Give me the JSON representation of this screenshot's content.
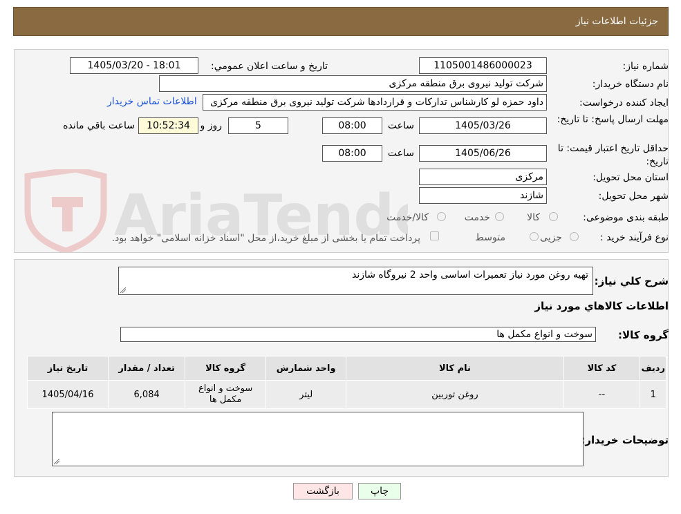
{
  "header": {
    "title": "جزئیات اطلاعات نیاز"
  },
  "watermark": {
    "text": "AriaTender.neT"
  },
  "form": {
    "need_number_label": "شماره نیاز:",
    "need_number": "1105001486000023",
    "announce_label": "تاریخ و ساعت اعلان عمومي:",
    "announce_value": "1405/03/20 - 18:01",
    "buyer_org_label": "نام دستگاه خریدار:",
    "buyer_org": "شرکت تولید نیروی برق منطقه مرکزی",
    "requester_label": "ایجاد کننده درخواست:",
    "requester": "داود حمزه لو کارشناس تدارکات و قراردادها شرکت تولید نیروی برق منطقه مرکزی",
    "contact_link": "اطلاعات تماس خریدار",
    "deadline_label": "مهلت ارسال پاسخ: تا تاریخ:",
    "deadline_date": "1405/03/26",
    "time_label": "ساعت",
    "deadline_time": "08:00",
    "days": "5",
    "days_label": "روز و",
    "remaining_time": "10:52:34",
    "remaining_label": "ساعت باقي مانده",
    "validity_label": "حداقل تاریخ اعتبار قیمت: تا تاریخ:",
    "validity_date": "1405/06/26",
    "validity_time": "08:00",
    "province_label": "استان محل تحویل:",
    "province": "مرکزی",
    "city_label": "شهر محل تحویل:",
    "city": "شازند",
    "category_label": "طبقه بندی موضوعی:",
    "category_options": [
      "کالا",
      "خدمت",
      "کالا/خدمت"
    ],
    "process_label": "نوع فرآیند خرید :",
    "process_options": [
      "جزیی",
      "متوسط"
    ],
    "payment_text": "پرداخت تمام یا بخشی از مبلغ خرید،از محل \"اسناد خزانه اسلامی\" خواهد بود."
  },
  "details": {
    "summary_label": "شرح کلي نياز:",
    "summary": "تهیه روغن مورد نیاز تعمیرات اساسی واحد 2 نیروگاه شازند",
    "goods_info_title": "اطلاعات کالاهاي مورد نياز",
    "goods_group_label": "گروه کالا:",
    "goods_group": "سوخت و انواع مکمل ها",
    "table": {
      "headers": [
        "رديف",
        "کد کالا",
        "نام کالا",
        "واحد شمارش",
        "گروه کالا",
        "تعداد / مقدار",
        "تاریخ نیاز"
      ],
      "rows": [
        [
          "1",
          "--",
          "روغن توربین",
          "لیتر",
          "سوخت و انواع مکمل ها",
          "6,084",
          "1405/04/16"
        ]
      ]
    },
    "buyer_notes_label": "توضیحات خریدار:",
    "buyer_notes": ""
  },
  "buttons": {
    "print": "چاپ",
    "back": "بازگشت"
  },
  "colors": {
    "header": "#8a6a41",
    "link": "#1a4fd6",
    "remaining_bg": "#fffbd9",
    "print_bg": "#eaffea",
    "back_bg": "#ffe6e6"
  }
}
